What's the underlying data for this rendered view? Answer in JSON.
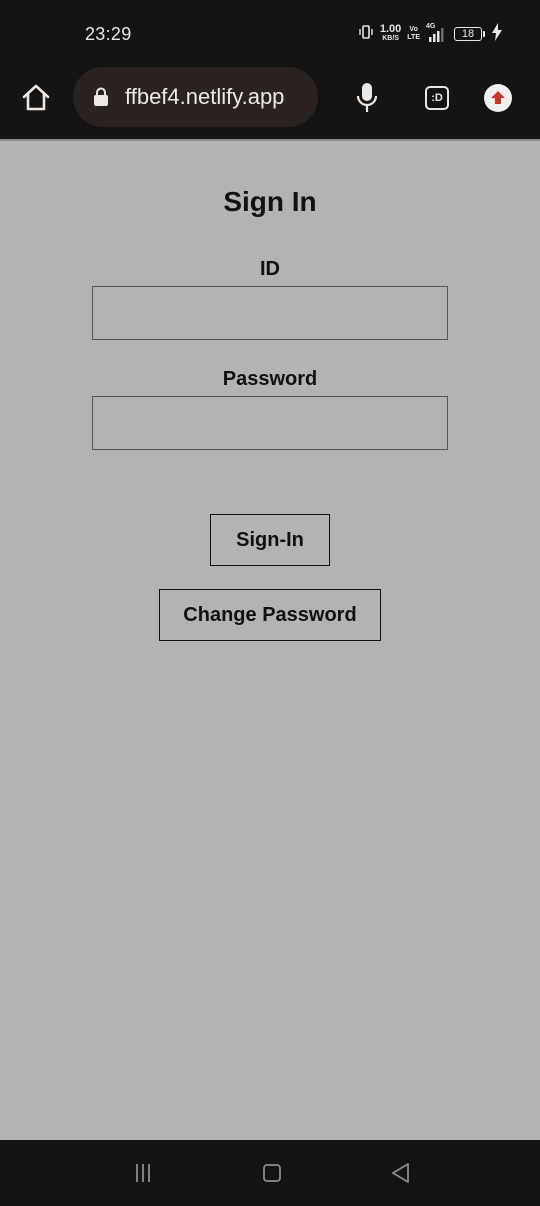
{
  "status_bar": {
    "time": "23:29",
    "net_speed_value": "1.00",
    "net_speed_unit": "KB/S",
    "volte_top": "Vo",
    "volte_bottom": "LTE",
    "network_type": "4G",
    "battery_level": "18"
  },
  "browser": {
    "url": "ffbef4.netlify.app",
    "tab_badge": ":D"
  },
  "page": {
    "title": "Sign In",
    "id_label": "ID",
    "id_value": "",
    "password_label": "Password",
    "password_value": "",
    "signin_button": "Sign-In",
    "change_password_button": "Change Password"
  },
  "icons": {
    "home": "home-icon",
    "lock": "lock-icon",
    "mic": "mic-icon",
    "tab": "tab-switcher-icon",
    "upload": "upload-icon",
    "vibrate": "vibrate-icon",
    "signal": "signal-icon",
    "charging": "charging-icon",
    "nav_recents": "recents-icon",
    "nav_home": "nav-home-icon",
    "nav_back": "back-icon"
  },
  "colors": {
    "bar_background": "#161413",
    "page_background": "#b3b3b3",
    "upload_arrow": "#c0392b"
  }
}
